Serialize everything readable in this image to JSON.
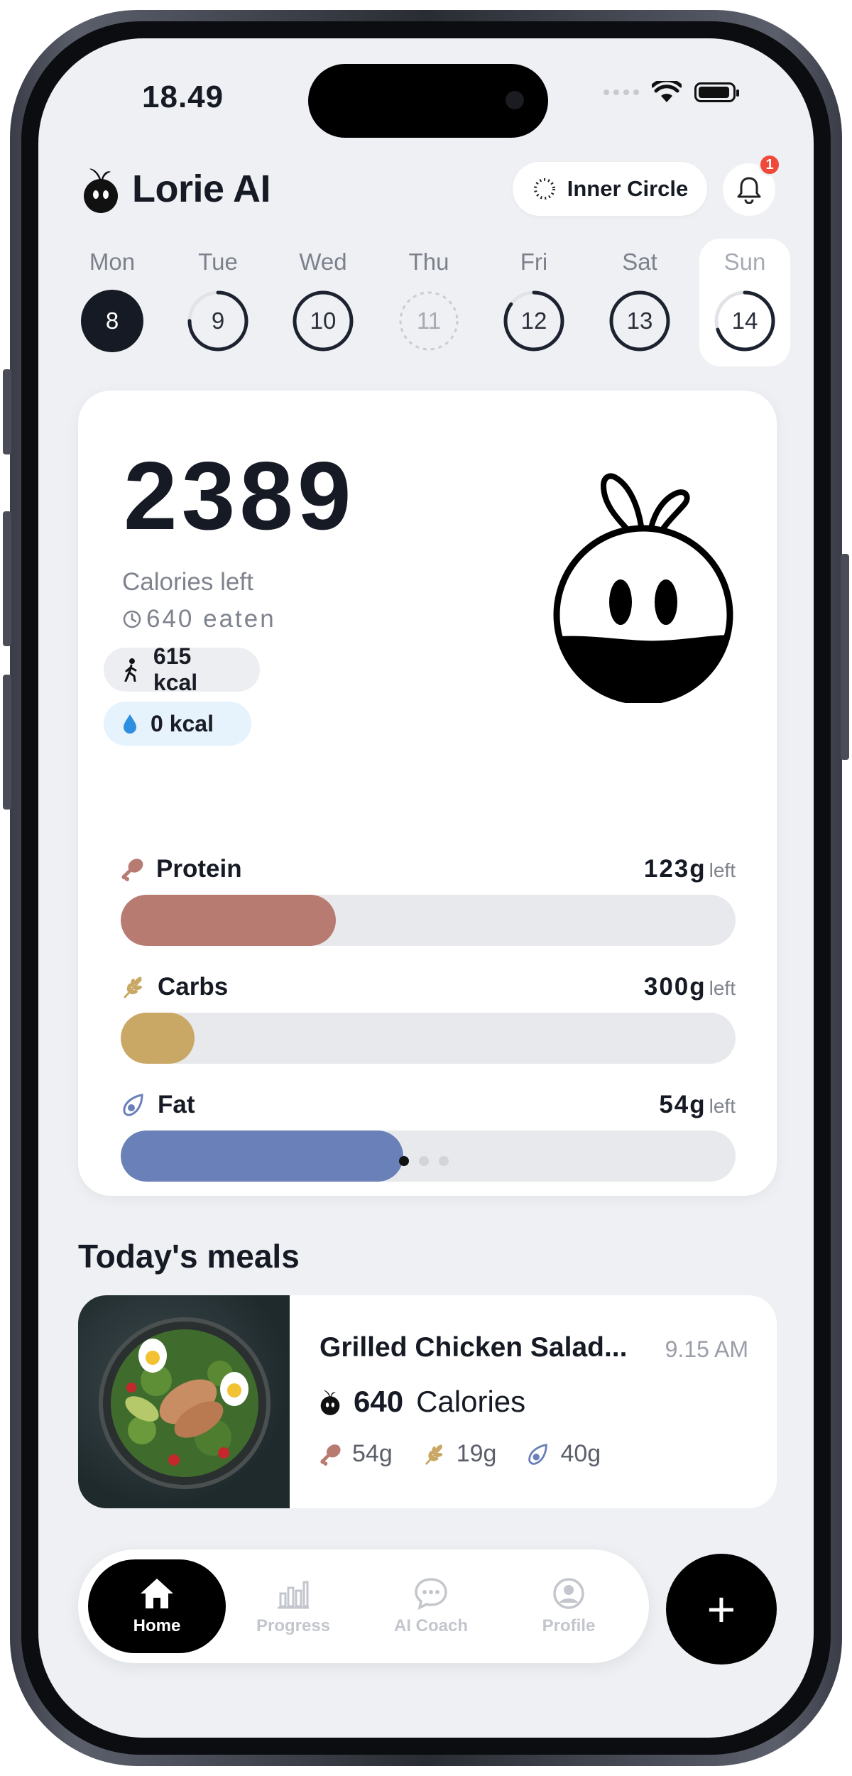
{
  "status_bar": {
    "time": "18.49"
  },
  "header": {
    "title": "Lorie AI",
    "inner_circle_label": "Inner Circle",
    "notification_count": "1"
  },
  "week": [
    {
      "name": "Mon",
      "date": "8",
      "state": "selected",
      "progress": 1.0
    },
    {
      "name": "Tue",
      "date": "9",
      "state": "partial",
      "progress": 0.75
    },
    {
      "name": "Wed",
      "date": "10",
      "state": "complete",
      "progress": 1.0
    },
    {
      "name": "Thu",
      "date": "11",
      "state": "empty",
      "progress": 0
    },
    {
      "name": "Fri",
      "date": "12",
      "state": "partial",
      "progress": 0.85
    },
    {
      "name": "Sat",
      "date": "13",
      "state": "complete",
      "progress": 1.0
    },
    {
      "name": "Sun",
      "date": "14",
      "state": "today",
      "progress": 0.7
    }
  ],
  "summary": {
    "calories_left": "2389",
    "calories_left_label": "Calories left",
    "eaten": "640 eaten",
    "burned_kcal": "615 kcal",
    "water_kcal": "0  kcal"
  },
  "macros": [
    {
      "name": "Protein",
      "amount": "123g",
      "suffix": "left",
      "progress": 0.35,
      "color": "#b87b72",
      "icon": "drumstick-icon"
    },
    {
      "name": "Carbs",
      "amount": "300g",
      "suffix": "left",
      "progress": 0.12,
      "color": "#c9a866",
      "icon": "wheat-icon"
    },
    {
      "name": "Fat",
      "amount": "54g",
      "suffix": "left",
      "progress": 0.46,
      "color": "#6a80b8",
      "icon": "avocado-icon"
    }
  ],
  "pager": {
    "pages": 3,
    "active": 0
  },
  "meals_section": {
    "title": "Today's meals"
  },
  "meals": [
    {
      "name": "Grilled Chicken Salad...",
      "time": "9.15 AM",
      "calories": "640",
      "calories_label": "Calories",
      "protein": "54g",
      "carbs": "19g",
      "fat": "40g"
    }
  ],
  "nav": {
    "items": [
      {
        "label": "Home",
        "icon": "home-icon",
        "active": true
      },
      {
        "label": "Progress",
        "icon": "bar-chart-icon",
        "active": false
      },
      {
        "label": "AI Coach",
        "icon": "chat-bubble-icon",
        "active": false
      },
      {
        "label": "Profile",
        "icon": "profile-icon",
        "active": false
      }
    ],
    "fab_label": "+"
  }
}
